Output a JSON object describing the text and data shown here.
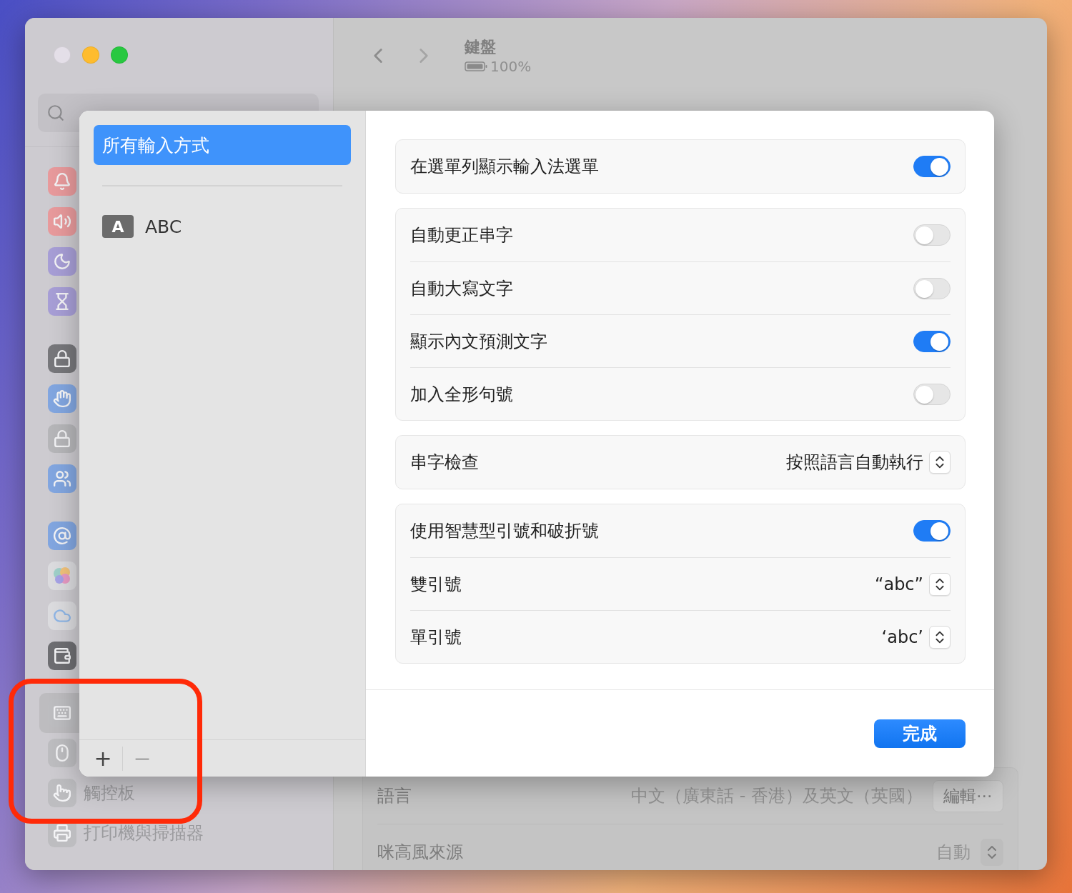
{
  "window": {
    "traffic_lights": [
      {
        "color": "#e4dfe8"
      },
      {
        "color": "#febc2e"
      },
      {
        "color": "#28c840"
      }
    ]
  },
  "sidebar": {
    "groups": [
      [
        {
          "kind": "bell",
          "color": "#e89a9c",
          "selected": false
        },
        {
          "kind": "speaker",
          "color": "#e89a9c",
          "selected": false
        },
        {
          "kind": "moon",
          "color": "#a79ed6",
          "selected": false
        },
        {
          "kind": "hourglass",
          "color": "#a79ed6",
          "selected": false
        }
      ],
      [
        {
          "kind": "lock-dots",
          "color": "#77777b",
          "selected": false
        },
        {
          "kind": "hand",
          "color": "#82a6e0",
          "selected": false
        },
        {
          "kind": "lock",
          "color": "#b6b6b9",
          "selected": false
        },
        {
          "kind": "people",
          "color": "#82a6e0",
          "selected": false
        }
      ],
      [
        {
          "kind": "at",
          "color": "#82a6e0",
          "selected": false
        },
        {
          "kind": "bubbles",
          "color": "#dcdcdf",
          "selected": false
        },
        {
          "kind": "cloud",
          "color": "#dcdcdf",
          "selected": false
        },
        {
          "kind": "wallet",
          "color": "#6e6e72",
          "selected": false
        }
      ],
      [
        {
          "kind": "keyboard",
          "color": "#bdbdc0",
          "selected": true
        },
        {
          "kind": "mouse",
          "color": "#bdbdc0",
          "selected": false
        },
        {
          "kind": "trackpad",
          "color": "#bdbdc0",
          "selected": false,
          "label": "觸控板"
        },
        {
          "kind": "printer",
          "color": "#bdbdc0",
          "selected": false,
          "label": "打印機與掃描器"
        }
      ]
    ]
  },
  "header": {
    "title": "鍵盤",
    "battery": "100%"
  },
  "background_settings": [
    {
      "kind": "button",
      "label": "語言",
      "value": "中文（廣東話 - 香港）及英文（英國）",
      "button": "編輯⋯"
    },
    {
      "kind": "popup",
      "label": "咪高風來源",
      "value": "自動"
    }
  ],
  "sheet": {
    "input_sources": [
      {
        "label": "所有輸入方式",
        "selected": true
      },
      {
        "label": "ABC",
        "badge": "A",
        "selected": false
      }
    ],
    "toolbar": [
      {
        "label": "+",
        "disabled": false
      },
      {
        "label": "−",
        "disabled": true
      }
    ],
    "groups": [
      [
        {
          "kind": "toggle",
          "label": "在選單列顯示輸入法選單",
          "on": true
        }
      ],
      [
        {
          "kind": "toggle",
          "label": "自動更正串字",
          "on": false
        },
        {
          "kind": "toggle",
          "label": "自動大寫文字",
          "on": false
        },
        {
          "kind": "toggle",
          "label": "顯示內文預測文字",
          "on": true
        },
        {
          "kind": "toggle",
          "label": "加入全形句號",
          "on": false
        }
      ],
      [
        {
          "kind": "popup",
          "label": "串字檢查",
          "value": "按照語言自動執行"
        }
      ],
      [
        {
          "kind": "toggle",
          "label": "使用智慧型引號和破折號",
          "on": true
        },
        {
          "kind": "popup",
          "label": "雙引號",
          "value": "“abc”"
        },
        {
          "kind": "popup",
          "label": "單引號",
          "value": "‘abc’"
        }
      ]
    ],
    "done_button": "完成"
  },
  "annotation": {
    "kind": "rectangle"
  }
}
